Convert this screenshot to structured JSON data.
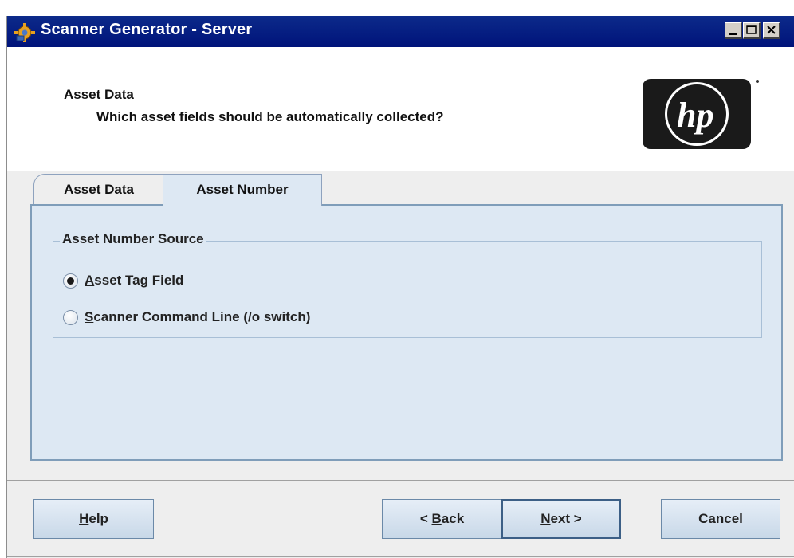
{
  "window": {
    "title": "Scanner Generator - Server",
    "controls": [
      "minimize-icon",
      "maximize-icon",
      "close-icon"
    ]
  },
  "header": {
    "title": "Asset Data",
    "subtitle": "Which asset fields should be automatically collected?",
    "logo": "hp"
  },
  "tabs": [
    {
      "label": "Asset Data",
      "selected": false
    },
    {
      "label": "Asset Number",
      "selected": true
    }
  ],
  "group": {
    "title": "Asset Number Source",
    "options": [
      {
        "mnemonic": "A",
        "rest": "sset Tag Field",
        "selected": true
      },
      {
        "mnemonic": "S",
        "rest": "canner Command Line (/o switch)",
        "selected": false
      }
    ]
  },
  "buttons": {
    "help": {
      "mnemonic": "H",
      "rest": "elp"
    },
    "back": {
      "prefix": "< ",
      "mnemonic": "B",
      "rest": "ack"
    },
    "next": {
      "mnemonic": "N",
      "rest": "ext >"
    },
    "cancel": "Cancel"
  },
  "colors": {
    "titlebar": "#0a1f86",
    "panel": "#dde8f3",
    "dialog_bg": "#eeeeee"
  }
}
